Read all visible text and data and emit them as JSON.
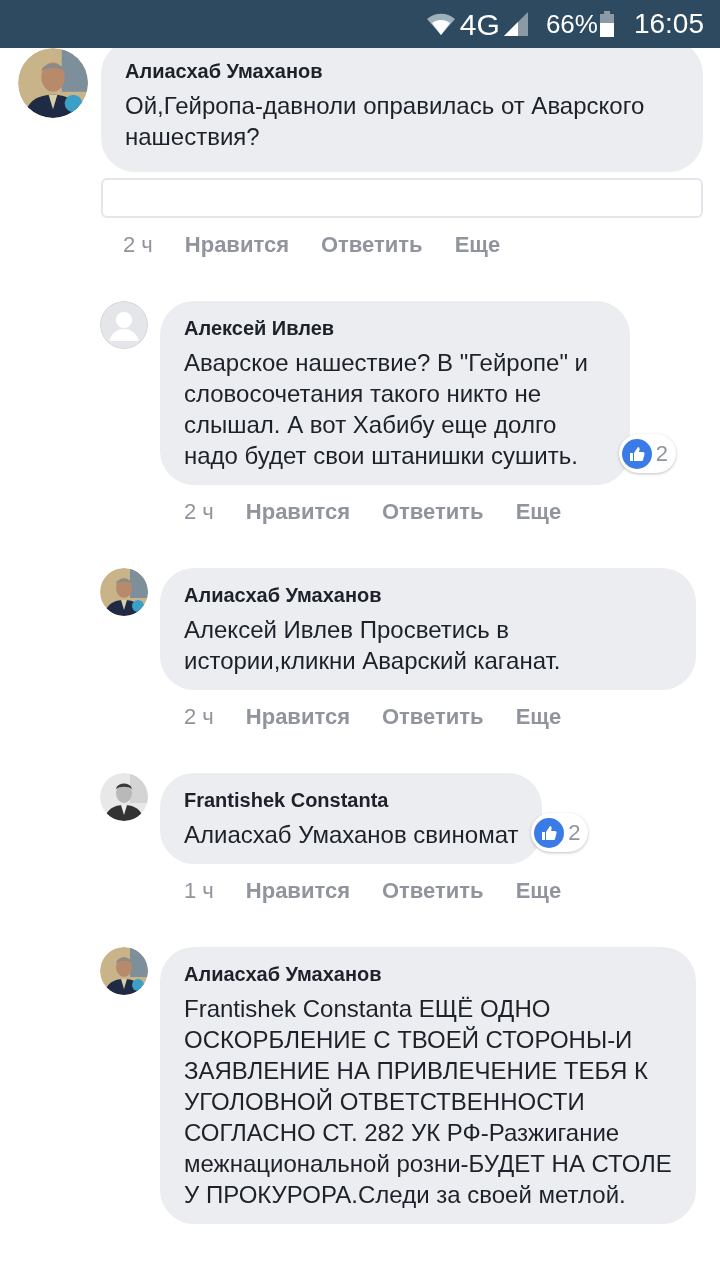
{
  "status_bar": {
    "network": "4G",
    "battery": "66%",
    "time": "16:05"
  },
  "comments": [
    {
      "name": "Алиасхаб Умаханов",
      "text": "Ой,Гейропа-давноли оправилась от Аварского нашествия?",
      "reply_field": true,
      "time": "2 ч",
      "actions": [
        "Нравится",
        "Ответить",
        "Еще"
      ]
    },
    {
      "avatar": {
        "kind": "default"
      },
      "name": "Алексей Ивлев",
      "text": "Аварское нашествие? В \"Гейропе\" и словосочетания такого никто не слышал. А вот Хабибу еще долго надо будет свои штанишки сушить.",
      "likes": "2",
      "time": "2 ч",
      "actions": [
        "Нравится",
        "Ответить",
        "Еще"
      ]
    },
    {
      "name": "Алиасхаб Умаханов",
      "text": "Алексей Ивлев Просветись в истории,кликни Аварский каганат.",
      "time": "2 ч",
      "actions": [
        "Нравится",
        "Ответить",
        "Еще"
      ]
    },
    {
      "avatar": {
        "kind": "photo_bw"
      },
      "name": "Frantishek Constanta",
      "text": "Алиасхаб Умаханов свиномат",
      "likes": "2",
      "time": "1 ч",
      "actions": [
        "Нравится",
        "Ответить",
        "Еще"
      ]
    },
    {
      "name": "Алиасхаб Умаханов",
      "text": "Frantishek Constanta ЕЩЁ ОДНО ОСКОРБЛЕНИЕ С ТВОЕЙ СТОРОНЫ-И ЗАЯВЛЕНИЕ НА ПРИВЛЕЧЕНИЕ ТЕБЯ К УГОЛОВНОЙ ОТВЕТСТВЕННОСТИ СОГЛАСНО СТ. 282 УК РФ-Разжигание межнациональной розни-БУДЕТ НА СТОЛЕ У ПРОКУРОРА.Следи за своей метлой."
    }
  ]
}
